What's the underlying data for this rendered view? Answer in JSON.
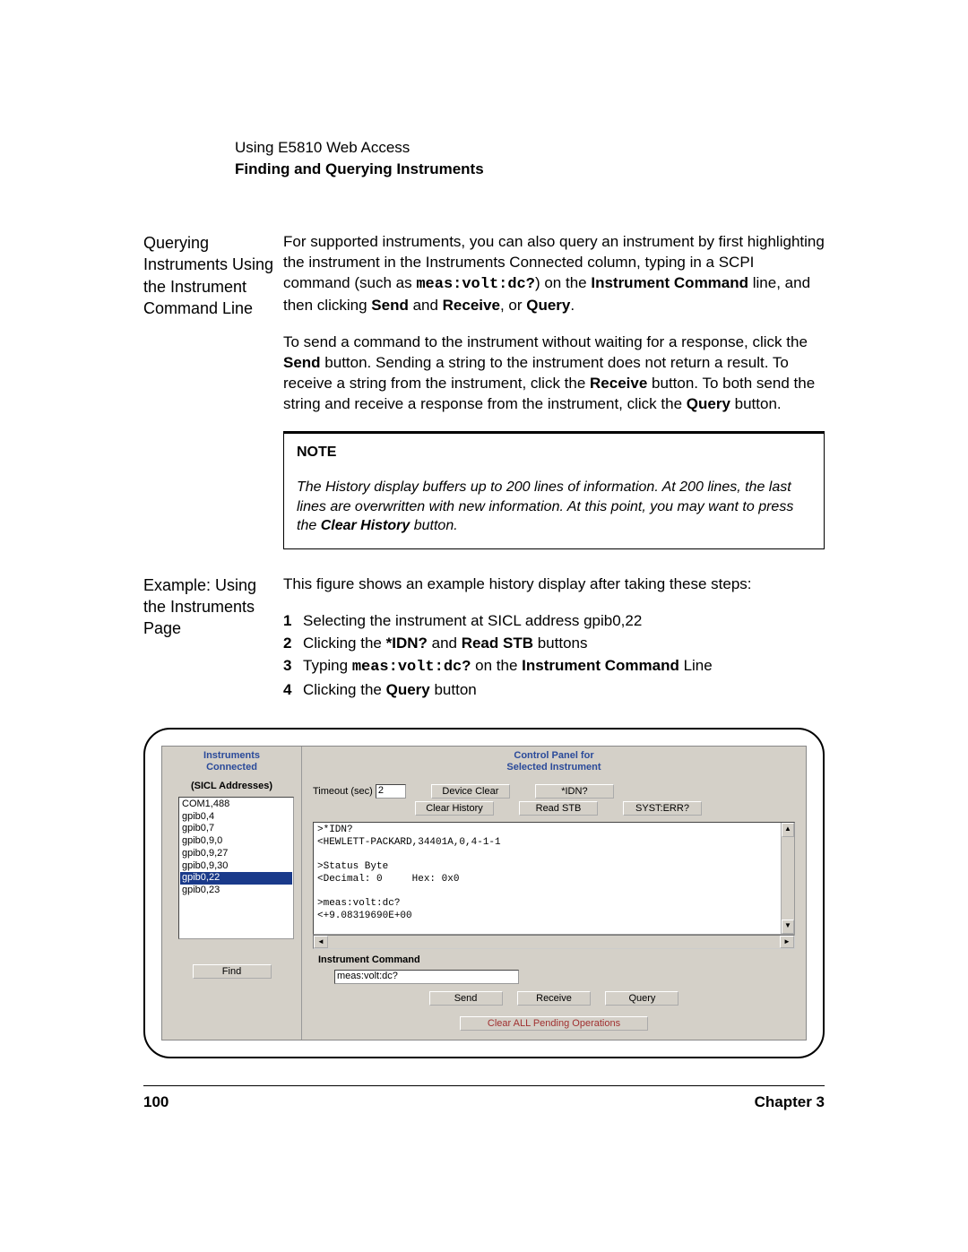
{
  "header": {
    "top_line": "Using E5810 Web Access",
    "title": "Finding and Querying Instruments"
  },
  "section1": {
    "heading": "Querying Instruments Using the Instrument Command Line",
    "para1_pre": "For supported instruments, you can also query an instrument by first highlighting the instrument in the Instruments Connected column, typing in a SCPI command (such as ",
    "para1_cmd": "meas:volt:dc?",
    "para1_mid": ") on the ",
    "para1_bold1": "Instrument Command",
    "para1_post1": " line, and then clicking ",
    "para1_bold2": "Send",
    "para1_and": " and ",
    "para1_bold3": "Receive",
    "para1_or": ", or ",
    "para1_bold4": "Query",
    "para1_end": ".",
    "para2_pre": "To send a command to the instrument without waiting for a response, click the ",
    "para2_b1": "Send",
    "para2_mid1": " button. Sending a string to the instrument does not return a result. To receive a string from the instrument, click the ",
    "para2_b2": "Receive",
    "para2_mid2": " button. To both send the string and receive a response from the instrument, click the ",
    "para2_b3": "Query",
    "para2_end": " button."
  },
  "note": {
    "label": "NOTE",
    "body_pre": "The History display buffers up to 200 lines of information. At 200 lines, the last lines are overwritten with new information. At this point, you may want to press the ",
    "body_bold": "Clear History",
    "body_post": " button."
  },
  "section2": {
    "heading": "Example: Using the Instruments Page",
    "intro": "This figure shows an example history display after taking these steps:",
    "steps": [
      {
        "n": "1",
        "pre": "Selecting the instrument at SICL address gpib0,22",
        "segments": []
      },
      {
        "n": "2",
        "pre": "Clicking the ",
        "b1": "*IDN?",
        "mid": " and ",
        "b2": "Read STB",
        "post": " buttons"
      },
      {
        "n": "3",
        "pre": "Typing ",
        "mono": "meas:volt:dc?",
        "mid": " on the ",
        "b1": "Instrument Command",
        "post": " Line"
      },
      {
        "n": "4",
        "pre": "Clicking the ",
        "b1": "Query",
        "post": " button"
      }
    ]
  },
  "panel": {
    "left_title": "Instruments\nConnected",
    "right_title": "Control Panel for\nSelected Instrument",
    "sicl_label": "(SICL Addresses)",
    "addresses": [
      "COM1,488",
      "gpib0,4",
      "gpib0,7",
      "gpib0,9,0",
      "gpib0,9,27",
      "gpib0,9,30",
      "gpib0,22",
      "gpib0,23"
    ],
    "selected_index": 6,
    "find_btn": "Find",
    "timeout_label": "Timeout (sec)",
    "timeout_value": "2",
    "buttons_row1": [
      "Device Clear",
      "*IDN?"
    ],
    "buttons_row2": [
      "Clear History",
      "Read STB",
      "SYST:ERR?"
    ],
    "history_text": ">*IDN?\n<HEWLETT-PACKARD,34401A,0,4-1-1\n\n>Status Byte\n<Decimal: 0     Hex: 0x0\n\n>meas:volt:dc?\n<+9.08319690E+00",
    "cmd_label": "Instrument Command",
    "cmd_value": "meas:volt:dc?",
    "send_btn": "Send",
    "receive_btn": "Receive",
    "query_btn": "Query",
    "clear_ops": "Clear ALL Pending Operations"
  },
  "footer": {
    "page_num": "100",
    "chapter": "Chapter 3"
  }
}
